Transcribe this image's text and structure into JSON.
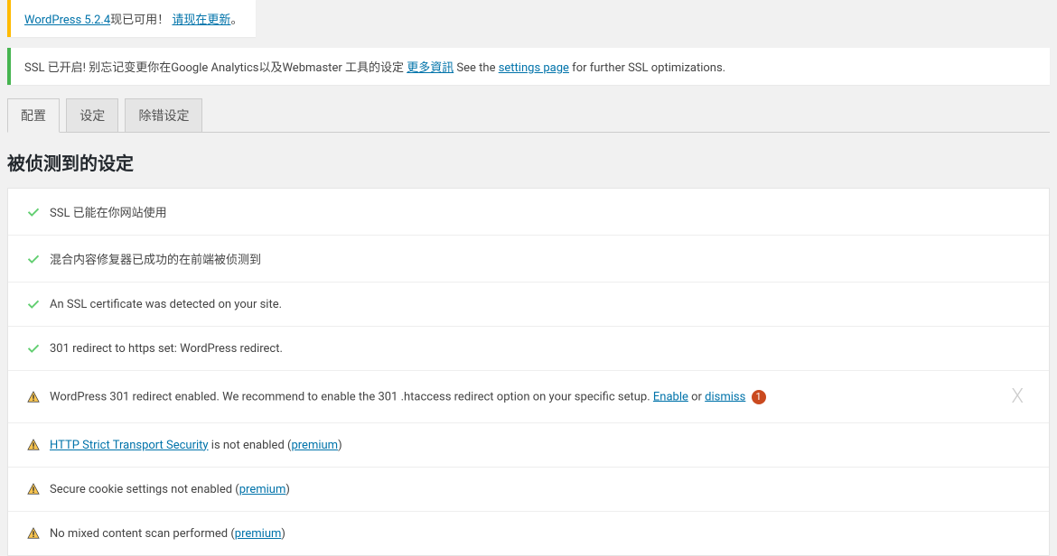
{
  "update_notice": {
    "version_link": "WordPress 5.2.4",
    "available_text": "现已可用！",
    "update_link": "请现在更新",
    "period": "。"
  },
  "ssl_notice": {
    "prefix": "SSL 已开启!  别忘记变更你在Google Analytics以及Webmaster 工具的设定 ",
    "more_info": "更多資訊",
    "see_the": " See the ",
    "settings_page": "settings page",
    "suffix": " for further SSL optimizations."
  },
  "tabs": [
    {
      "label": "配置",
      "active": true
    },
    {
      "label": "设定",
      "active": false
    },
    {
      "label": "除错设定",
      "active": false
    }
  ],
  "section_title": "被侦测到的设定",
  "items": [
    {
      "status": "ok",
      "text": "SSL 已能在你网站使用"
    },
    {
      "status": "ok",
      "text": "混合内容修复器已成功的在前端被侦测到"
    },
    {
      "status": "ok",
      "text": "An SSL certificate was detected on your site."
    },
    {
      "status": "ok",
      "text": "301 redirect to https set: WordPress redirect."
    },
    {
      "status": "warn",
      "text": "WordPress 301 redirect enabled. We recommend to enable the 301 .htaccess redirect option on your specific setup. ",
      "enable_link": "Enable",
      "or_text": " or  ",
      "dismiss_link": "dismiss",
      "badge": "1",
      "closable": true
    },
    {
      "status": "warn",
      "link": "HTTP Strict Transport Security",
      "mid_text": " is not enabled ",
      "premium_prefix": "(",
      "premium_link": "premium",
      "premium_suffix": ")"
    },
    {
      "status": "warn",
      "text": "Secure cookie settings not enabled ",
      "premium_prefix": "(",
      "premium_link": "premium",
      "premium_suffix": ")"
    },
    {
      "status": "warn",
      "text": "No mixed content scan performed ",
      "premium_prefix": "(",
      "premium_link": "premium",
      "premium_suffix": ")"
    }
  ]
}
